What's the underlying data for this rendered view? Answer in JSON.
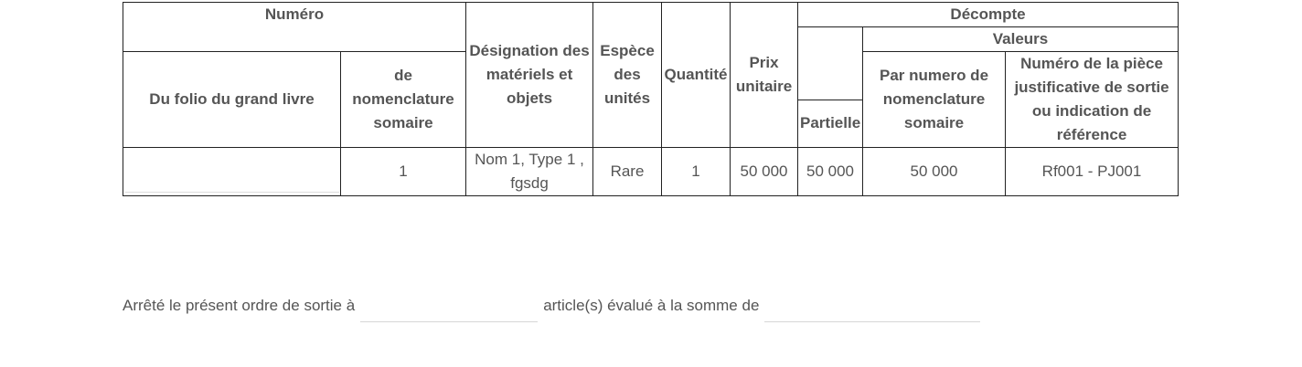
{
  "table": {
    "headers": {
      "numero": "Numéro",
      "decompte": "Décompte",
      "valeurs": "Valeurs",
      "folio": "Du folio du grand livre",
      "nomenclature": "de nomenclature somaire",
      "designation": "Désignation des matériels et objets",
      "espece": "Espèce des unités",
      "quantite": "Quantité",
      "prix": "Prix unitaire",
      "partielle": "Partielle",
      "par_numero": "Par numero de nomenclature somaire",
      "piece": "Numéro de la pièce justificative de sortie ou indication de référence"
    },
    "rows": [
      {
        "folio": "",
        "nomenclature": "1",
        "designation": "Nom 1, Type 1 , fgsdg",
        "espece": "Rare",
        "quantite": "1",
        "prix": "50 000",
        "partielle": "50 000",
        "par_numero": "50 000",
        "piece": "Rf001 - PJ001"
      }
    ]
  },
  "footer": {
    "text_1": "Arrêté le présent ordre de sortie à",
    "input_1_value": "",
    "text_2": "article(s) évalué à la somme de",
    "input_2_value": ""
  }
}
